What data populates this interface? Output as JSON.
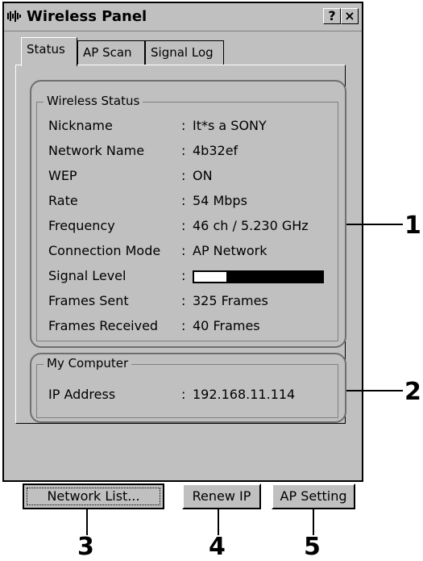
{
  "window": {
    "title": "Wireless Panel",
    "help_label": "?",
    "close_label": "×"
  },
  "tabs": [
    {
      "label": "Status",
      "active": true
    },
    {
      "label": "AP Scan",
      "active": false
    },
    {
      "label": "Signal Log",
      "active": false
    }
  ],
  "wireless_status": {
    "title": "Wireless Status",
    "rows": [
      {
        "label": "Nickname",
        "value": "It*s a SONY"
      },
      {
        "label": "Network Name",
        "value": "4b32ef"
      },
      {
        "label": "WEP",
        "value": "ON"
      },
      {
        "label": "Rate",
        "value": "54 Mbps"
      },
      {
        "label": "Frequency",
        "value": "46 ch / 5.230 GHz"
      },
      {
        "label": "Connection Mode",
        "value": "AP Network"
      },
      {
        "label": "Signal Level",
        "value": ""
      },
      {
        "label": "Frames Sent",
        "value": "325 Frames"
      },
      {
        "label": "Frames Received",
        "value": "40 Frames"
      }
    ],
    "signal_level_fraction": 0.25
  },
  "my_computer": {
    "title": "My Computer",
    "rows": [
      {
        "label": "IP Address",
        "value": "192.168.11.114"
      }
    ]
  },
  "colon": ":",
  "buttons": {
    "network_list": "Network List...",
    "renew_ip": "Renew IP",
    "ap_setting": "AP Setting"
  },
  "callouts": [
    "1",
    "2",
    "3",
    "4",
    "5"
  ]
}
